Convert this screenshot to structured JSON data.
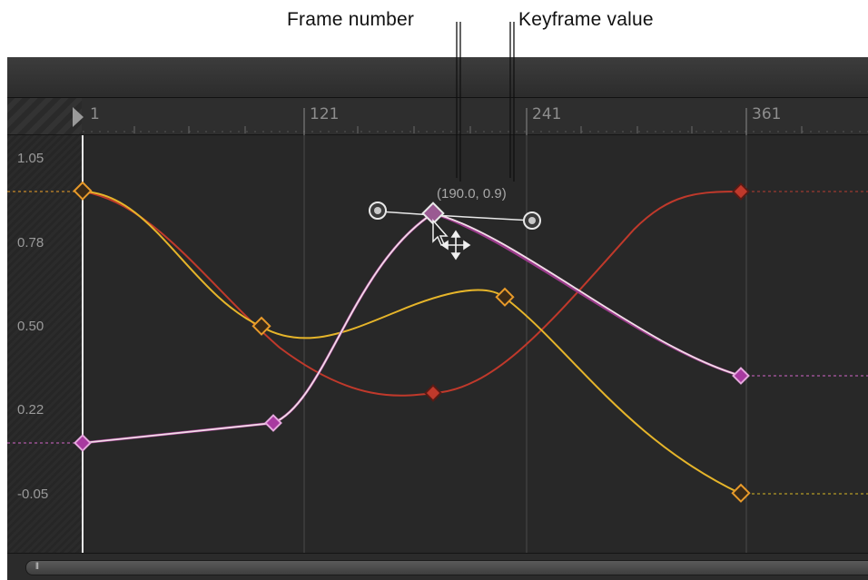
{
  "callouts": {
    "frame_number": "Frame number",
    "keyframe_value": "Keyframe value"
  },
  "ruler": {
    "frames": [
      "1",
      "121",
      "241",
      "361"
    ]
  },
  "value_axis": {
    "labels": [
      "1.05",
      "0.78",
      "0.50",
      "0.22",
      "-0.05"
    ]
  },
  "readout": "(190.0, 0.9)",
  "colors": {
    "orange_curve": "#e6b52a",
    "red_curve": "#c0392b",
    "white_curve": "#f2dde8",
    "magenta_keyframe": "#b03aa6",
    "orange_keyframe": "#e89a2a"
  },
  "icons": {
    "playhead": "playhead-icon",
    "cursor": "arrow-cursor-icon",
    "move": "move-cursor-icon"
  }
}
